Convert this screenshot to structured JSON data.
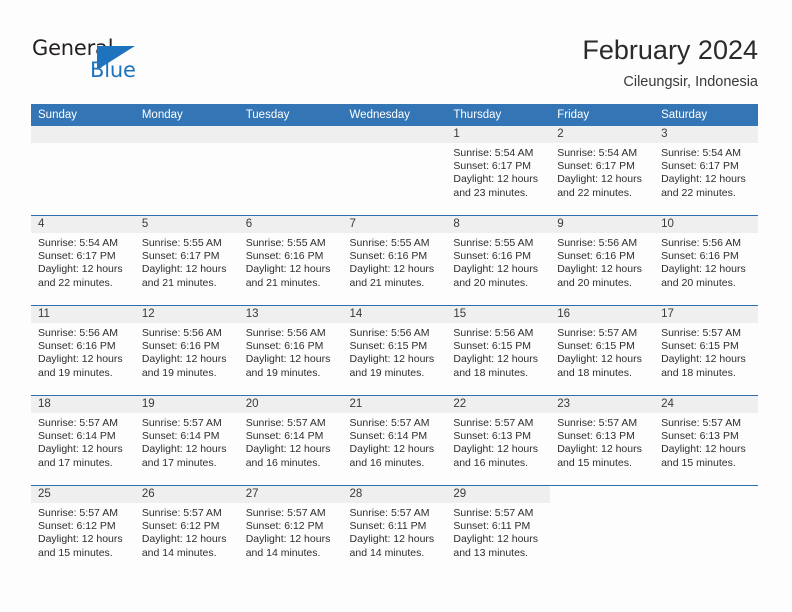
{
  "brand": {
    "name_part1": "General",
    "name_part2": "Blue",
    "flag_icon": "blue-triangle-flag-icon",
    "accent_color": "#1e73be"
  },
  "header": {
    "title": "February 2024",
    "location": "Cileungsir, Indonesia"
  },
  "colors": {
    "header_row_bg": "#3375b5",
    "daynum_band_bg": "#efefef",
    "row_divider": "#2f6fae",
    "page_bg": "#fdfdfd",
    "text": "#2e2e2e"
  },
  "calendar": {
    "weekday_headers": [
      "Sunday",
      "Monday",
      "Tuesday",
      "Wednesday",
      "Thursday",
      "Friday",
      "Saturday"
    ],
    "weeks": [
      [
        {
          "day": "",
          "blank": true,
          "sunrise": "",
          "sunset": "",
          "daylight_line1": "",
          "daylight_line2": ""
        },
        {
          "day": "",
          "blank": true,
          "sunrise": "",
          "sunset": "",
          "daylight_line1": "",
          "daylight_line2": ""
        },
        {
          "day": "",
          "blank": true,
          "sunrise": "",
          "sunset": "",
          "daylight_line1": "",
          "daylight_line2": ""
        },
        {
          "day": "",
          "blank": true,
          "sunrise": "",
          "sunset": "",
          "daylight_line1": "",
          "daylight_line2": ""
        },
        {
          "day": "1",
          "blank": false,
          "sunrise": "Sunrise: 5:54 AM",
          "sunset": "Sunset: 6:17 PM",
          "daylight_line1": "Daylight: 12 hours",
          "daylight_line2": "and 23 minutes."
        },
        {
          "day": "2",
          "blank": false,
          "sunrise": "Sunrise: 5:54 AM",
          "sunset": "Sunset: 6:17 PM",
          "daylight_line1": "Daylight: 12 hours",
          "daylight_line2": "and 22 minutes."
        },
        {
          "day": "3",
          "blank": false,
          "sunrise": "Sunrise: 5:54 AM",
          "sunset": "Sunset: 6:17 PM",
          "daylight_line1": "Daylight: 12 hours",
          "daylight_line2": "and 22 minutes."
        }
      ],
      [
        {
          "day": "4",
          "blank": false,
          "sunrise": "Sunrise: 5:54 AM",
          "sunset": "Sunset: 6:17 PM",
          "daylight_line1": "Daylight: 12 hours",
          "daylight_line2": "and 22 minutes."
        },
        {
          "day": "5",
          "blank": false,
          "sunrise": "Sunrise: 5:55 AM",
          "sunset": "Sunset: 6:17 PM",
          "daylight_line1": "Daylight: 12 hours",
          "daylight_line2": "and 21 minutes."
        },
        {
          "day": "6",
          "blank": false,
          "sunrise": "Sunrise: 5:55 AM",
          "sunset": "Sunset: 6:16 PM",
          "daylight_line1": "Daylight: 12 hours",
          "daylight_line2": "and 21 minutes."
        },
        {
          "day": "7",
          "blank": false,
          "sunrise": "Sunrise: 5:55 AM",
          "sunset": "Sunset: 6:16 PM",
          "daylight_line1": "Daylight: 12 hours",
          "daylight_line2": "and 21 minutes."
        },
        {
          "day": "8",
          "blank": false,
          "sunrise": "Sunrise: 5:55 AM",
          "sunset": "Sunset: 6:16 PM",
          "daylight_line1": "Daylight: 12 hours",
          "daylight_line2": "and 20 minutes."
        },
        {
          "day": "9",
          "blank": false,
          "sunrise": "Sunrise: 5:56 AM",
          "sunset": "Sunset: 6:16 PM",
          "daylight_line1": "Daylight: 12 hours",
          "daylight_line2": "and 20 minutes."
        },
        {
          "day": "10",
          "blank": false,
          "sunrise": "Sunrise: 5:56 AM",
          "sunset": "Sunset: 6:16 PM",
          "daylight_line1": "Daylight: 12 hours",
          "daylight_line2": "and 20 minutes."
        }
      ],
      [
        {
          "day": "11",
          "blank": false,
          "sunrise": "Sunrise: 5:56 AM",
          "sunset": "Sunset: 6:16 PM",
          "daylight_line1": "Daylight: 12 hours",
          "daylight_line2": "and 19 minutes."
        },
        {
          "day": "12",
          "blank": false,
          "sunrise": "Sunrise: 5:56 AM",
          "sunset": "Sunset: 6:16 PM",
          "daylight_line1": "Daylight: 12 hours",
          "daylight_line2": "and 19 minutes."
        },
        {
          "day": "13",
          "blank": false,
          "sunrise": "Sunrise: 5:56 AM",
          "sunset": "Sunset: 6:16 PM",
          "daylight_line1": "Daylight: 12 hours",
          "daylight_line2": "and 19 minutes."
        },
        {
          "day": "14",
          "blank": false,
          "sunrise": "Sunrise: 5:56 AM",
          "sunset": "Sunset: 6:15 PM",
          "daylight_line1": "Daylight: 12 hours",
          "daylight_line2": "and 19 minutes."
        },
        {
          "day": "15",
          "blank": false,
          "sunrise": "Sunrise: 5:56 AM",
          "sunset": "Sunset: 6:15 PM",
          "daylight_line1": "Daylight: 12 hours",
          "daylight_line2": "and 18 minutes."
        },
        {
          "day": "16",
          "blank": false,
          "sunrise": "Sunrise: 5:57 AM",
          "sunset": "Sunset: 6:15 PM",
          "daylight_line1": "Daylight: 12 hours",
          "daylight_line2": "and 18 minutes."
        },
        {
          "day": "17",
          "blank": false,
          "sunrise": "Sunrise: 5:57 AM",
          "sunset": "Sunset: 6:15 PM",
          "daylight_line1": "Daylight: 12 hours",
          "daylight_line2": "and 18 minutes."
        }
      ],
      [
        {
          "day": "18",
          "blank": false,
          "sunrise": "Sunrise: 5:57 AM",
          "sunset": "Sunset: 6:14 PM",
          "daylight_line1": "Daylight: 12 hours",
          "daylight_line2": "and 17 minutes."
        },
        {
          "day": "19",
          "blank": false,
          "sunrise": "Sunrise: 5:57 AM",
          "sunset": "Sunset: 6:14 PM",
          "daylight_line1": "Daylight: 12 hours",
          "daylight_line2": "and 17 minutes."
        },
        {
          "day": "20",
          "blank": false,
          "sunrise": "Sunrise: 5:57 AM",
          "sunset": "Sunset: 6:14 PM",
          "daylight_line1": "Daylight: 12 hours",
          "daylight_line2": "and 16 minutes."
        },
        {
          "day": "21",
          "blank": false,
          "sunrise": "Sunrise: 5:57 AM",
          "sunset": "Sunset: 6:14 PM",
          "daylight_line1": "Daylight: 12 hours",
          "daylight_line2": "and 16 minutes."
        },
        {
          "day": "22",
          "blank": false,
          "sunrise": "Sunrise: 5:57 AM",
          "sunset": "Sunset: 6:13 PM",
          "daylight_line1": "Daylight: 12 hours",
          "daylight_line2": "and 16 minutes."
        },
        {
          "day": "23",
          "blank": false,
          "sunrise": "Sunrise: 5:57 AM",
          "sunset": "Sunset: 6:13 PM",
          "daylight_line1": "Daylight: 12 hours",
          "daylight_line2": "and 15 minutes."
        },
        {
          "day": "24",
          "blank": false,
          "sunrise": "Sunrise: 5:57 AM",
          "sunset": "Sunset: 6:13 PM",
          "daylight_line1": "Daylight: 12 hours",
          "daylight_line2": "and 15 minutes."
        }
      ],
      [
        {
          "day": "25",
          "blank": false,
          "sunrise": "Sunrise: 5:57 AM",
          "sunset": "Sunset: 6:12 PM",
          "daylight_line1": "Daylight: 12 hours",
          "daylight_line2": "and 15 minutes."
        },
        {
          "day": "26",
          "blank": false,
          "sunrise": "Sunrise: 5:57 AM",
          "sunset": "Sunset: 6:12 PM",
          "daylight_line1": "Daylight: 12 hours",
          "daylight_line2": "and 14 minutes."
        },
        {
          "day": "27",
          "blank": false,
          "sunrise": "Sunrise: 5:57 AM",
          "sunset": "Sunset: 6:12 PM",
          "daylight_line1": "Daylight: 12 hours",
          "daylight_line2": "and 14 minutes."
        },
        {
          "day": "28",
          "blank": false,
          "sunrise": "Sunrise: 5:57 AM",
          "sunset": "Sunset: 6:11 PM",
          "daylight_line1": "Daylight: 12 hours",
          "daylight_line2": "and 14 minutes."
        },
        {
          "day": "29",
          "blank": false,
          "sunrise": "Sunrise: 5:57 AM",
          "sunset": "Sunset: 6:11 PM",
          "daylight_line1": "Daylight: 12 hours",
          "daylight_line2": "and 13 minutes."
        },
        {
          "day": "",
          "blank": true,
          "sunrise": "",
          "sunset": "",
          "daylight_line1": "",
          "daylight_line2": ""
        },
        {
          "day": "",
          "blank": true,
          "sunrise": "",
          "sunset": "",
          "daylight_line1": "",
          "daylight_line2": ""
        }
      ]
    ]
  }
}
